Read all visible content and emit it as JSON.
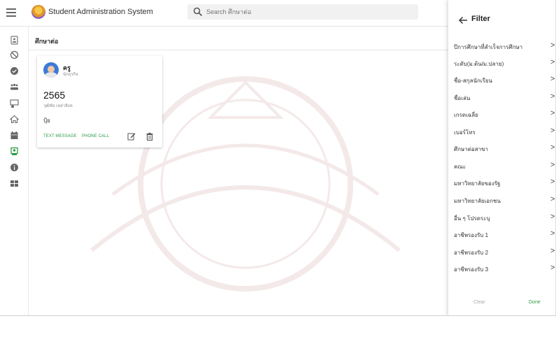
{
  "header": {
    "app_title": "Student Administration System",
    "search_placeholder": "Search ศึกษาต่อ"
  },
  "rail": {
    "icons": [
      "contact-card-icon",
      "block-icon",
      "check-circle-icon",
      "people-icon",
      "school-icon",
      "home-icon",
      "calendar-icon",
      "graduation-icon",
      "info-icon",
      "grid-icon"
    ],
    "active_index": 7
  },
  "section": {
    "title": "ศึกษาต่อ"
  },
  "card": {
    "name": "ครู",
    "role": "นักธุรกิจ",
    "year": "2565",
    "subtitle": "วุฒิชัย เหล่าสิงห",
    "nickname": "ปุ้ย",
    "text_message_label": "TEXT MESSAGE",
    "phone_call_label": "PHONE CALL"
  },
  "filter": {
    "title": "Filter",
    "items": [
      "ปีการศึกษาที่สำเร็จการศึกษา",
      "ระดับ(ม.ต้น/ม.ปลาย)",
      "ชื่อ-สกุลนักเรียน",
      "ชื่อเล่น",
      "เกรดเฉลี่ย",
      "เบอร์โทร",
      "ศึกษาต่อสาขา",
      "คณะ",
      "มหาวิทยาลัยของรัฐ",
      "มหาวิทยาลัยเอกชน",
      "อื่น ๆ โปรดระบุ",
      "อาชีพรองรับ 1",
      "อาชีพรองรับ 2",
      "อาชีพรองรับ 3"
    ],
    "chevron": ">",
    "clear_label": "Clear",
    "done_label": "Done"
  },
  "colors": {
    "accent_green": "#2e9b47",
    "rail_active": "#2e9b47"
  }
}
